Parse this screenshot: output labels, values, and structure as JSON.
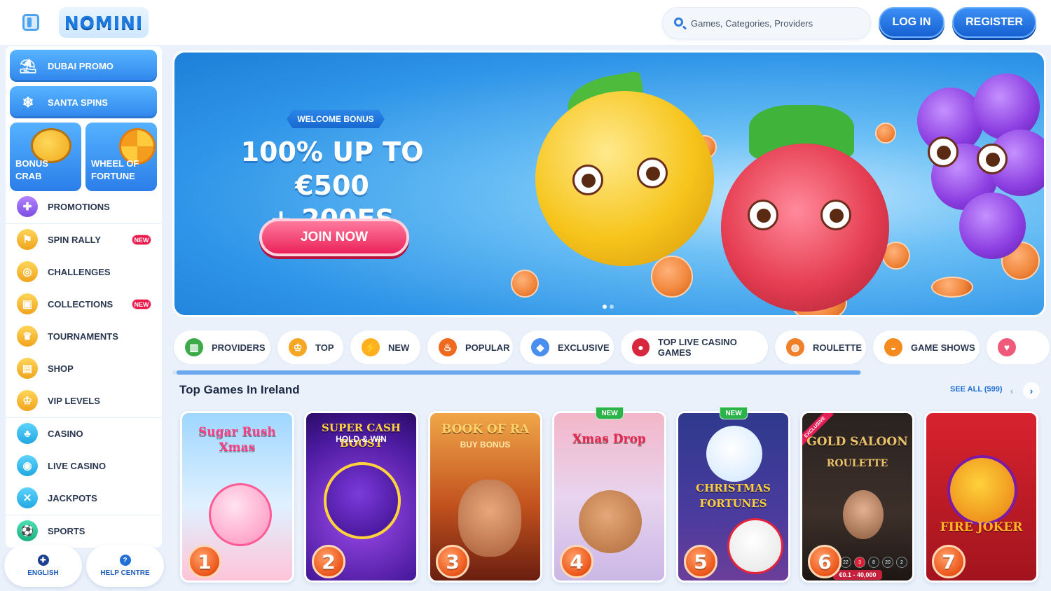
{
  "header": {
    "logo_text": "NOMINI",
    "search_placeholder": "Games, Categories, Providers",
    "login_label": "LOG IN",
    "register_label": "REGISTER"
  },
  "sidebar": {
    "promos": [
      {
        "label": "DUBAI PROMO",
        "icon": "palm-tower-icon"
      },
      {
        "label": "SANTA SPINS",
        "icon": "snowflake-icon"
      }
    ],
    "tiles": [
      {
        "label": "BONUS CRAB",
        "icon": "crab-icon"
      },
      {
        "label": "WHEEL OF FORTUNE",
        "icon": "wheel-icon"
      }
    ],
    "items": [
      {
        "label": "PROMOTIONS",
        "icon": "gift-icon",
        "badge": ""
      },
      {
        "label": "SPIN RALLY",
        "icon": "flag-icon",
        "badge": "NEW"
      },
      {
        "label": "CHALLENGES",
        "icon": "target-icon",
        "badge": ""
      },
      {
        "label": "COLLECTIONS",
        "icon": "cards-icon",
        "badge": "NEW"
      },
      {
        "label": "TOURNAMENTS",
        "icon": "trophy-icon",
        "badge": ""
      },
      {
        "label": "SHOP",
        "icon": "shop-icon",
        "badge": ""
      },
      {
        "label": "VIP LEVELS",
        "icon": "crown-icon",
        "badge": ""
      },
      {
        "label": "CASINO",
        "icon": "clover-icon",
        "badge": ""
      },
      {
        "label": "LIVE CASINO",
        "icon": "live-icon",
        "badge": ""
      },
      {
        "label": "JACKPOTS",
        "icon": "jackpot-icon",
        "badge": ""
      },
      {
        "label": "SPORTS",
        "icon": "ball-icon",
        "badge": ""
      }
    ],
    "footer": {
      "language_label": "ENGLISH",
      "help_label": "HELP CENTRE"
    }
  },
  "banner": {
    "tag": "WELCOME BONUS",
    "headline_line1": "100% UP TO €500",
    "headline_line2": "+ 200FS",
    "cta_label": "JOIN NOW",
    "slide_count": 2,
    "active_slide": 1
  },
  "categories": [
    {
      "label": "PROVIDERS",
      "icon": "book-icon"
    },
    {
      "label": "TOP",
      "icon": "crown-icon"
    },
    {
      "label": "NEW",
      "icon": "lightning-icon"
    },
    {
      "label": "POPULAR",
      "icon": "fire-icon"
    },
    {
      "label": "EXCLUSIVE",
      "icon": "diamond-icon"
    },
    {
      "label": "TOP LIVE CASINO GAMES",
      "icon": "chips-icon"
    },
    {
      "label": "ROULETTE",
      "icon": "roulette-icon"
    },
    {
      "label": "GAME SHOWS",
      "icon": "orange-icon"
    }
  ],
  "top_games": {
    "title": "Top Games In Ireland",
    "see_all_label": "SEE ALL (599)",
    "games": [
      {
        "rank": "1",
        "title": "Sugar Rush Xmas",
        "subtitle": "",
        "tag": ""
      },
      {
        "rank": "2",
        "title": "SUPER CASH BOOST",
        "subtitle": "HOLD & WIN",
        "tag": ""
      },
      {
        "rank": "3",
        "title": "BOOK OF RA",
        "subtitle": "BUY BONUS",
        "tag": ""
      },
      {
        "rank": "4",
        "title": "Xmas Drop",
        "subtitle": "",
        "tag": "NEW"
      },
      {
        "rank": "5",
        "title": "CHRISTMAS FORTUNES",
        "subtitle": "",
        "tag": "NEW"
      },
      {
        "rank": "6",
        "title": "GOLD SALOON",
        "subtitle": "ROULETTE",
        "tag": "EXCLUSIVE",
        "chips": [
          "22",
          "3",
          "8",
          "20",
          "2"
        ],
        "limits": "€0.1 - 40,000"
      },
      {
        "rank": "7",
        "title": "FIRE JOKER",
        "subtitle": "",
        "tag": ""
      }
    ]
  }
}
